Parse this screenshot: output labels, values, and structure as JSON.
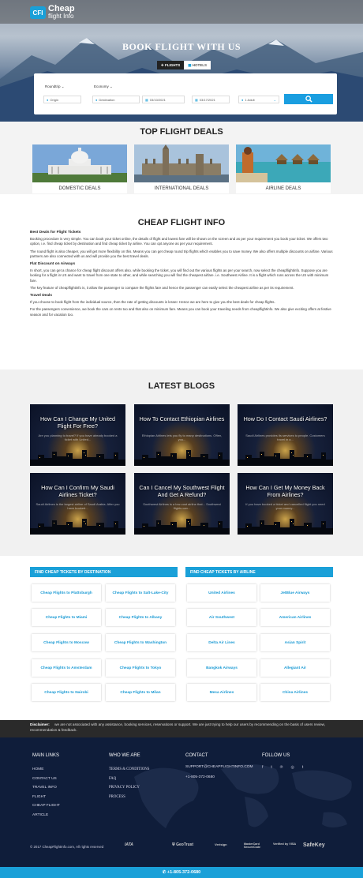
{
  "header": {
    "logo_badge": "CFI",
    "logo_line1": "Cheap",
    "logo_line2": "flight Info"
  },
  "hero": {
    "title": "BOOK FLIGHT WITH US",
    "tabs": [
      {
        "label": "FLIGHTS",
        "icon": "plane-icon",
        "active": true
      },
      {
        "label": "HOTELS",
        "icon": "hotel-icon",
        "active": false
      }
    ],
    "trip_type": "Roundtrip",
    "cabin_class": "Economy",
    "origin_placeholder": "Origin",
    "destination_placeholder": "Destination",
    "depart_date": "03/10/2021",
    "return_date": "03/17/2021",
    "passengers": "1 Adult"
  },
  "deals": {
    "title": "TOP FLIGHT DEALS",
    "items": [
      {
        "label": "DOMESTIC DEALS"
      },
      {
        "label": "INTERNATIONAL DEALS"
      },
      {
        "label": "AIRLINE DEALS"
      }
    ]
  },
  "info": {
    "title": "CHEAP FLIGHT INFO",
    "h1": "Best Deals for Flight Tickets",
    "p1": "Booking procedure is very simple. You can book your ticket online, the details of flight and lowest fare will be shown on the screen and as per your requirement you book your ticket. We offers two option, i.e. find cheap ticket by destination and find cheap ticket by airline. You can opt anyone as per your requirement.",
    "p2": "The round flight is also cheaper, you will get more flexibility on this. Means you can get cheap round trip flights which enables you to save money. We also offers multiple discounts on airfare. Various partners are also connected with us and will provide you the best travel deals.",
    "h2": "Flat Discount on Airways",
    "p3": "In short, you can get a chance for cheap flight discount offers also. while booking the ticket, you will find out the various flights as per your search, now select the cheapflightinfo. Suppose you are looking for a flight in US and want to travel from one state to other, and while searching you will find the cheapest airfare. i.e. Southwest Airline. It is a flight which runs across the US with minimum fare.",
    "p4": "The key feature of cheapflightinfo is, it allow the passenger to compare the flights fare and hence the passenger can easily select the cheapest airline as per its requirement.",
    "h3": "Travel Deals",
    "p5": "If you choose to book flight from the individual source, then the rate of getting discounts is lesser. Hence we are here to give you the best deals for cheap flights.",
    "p6": "For the passengers convenience, we book the cars on rents too and that also on minimum fare. Means you can book your traveling needs from cheapflightinfo. We also give exciting offers at festive season and for vacation too."
  },
  "blogs": {
    "title": "LATEST BLOGS",
    "items": [
      {
        "title": "How Can I Change My United Flight For Free?",
        "excerpt": "Are you planning to travel? If you have already booked a ticket with United..."
      },
      {
        "title": "How To Contact Ethiopian Airlines",
        "excerpt": "Ethiopian Airlines lets you fly to many destinations. Often, you..."
      },
      {
        "title": "How Do I Contact Saudi Airlines?",
        "excerpt": "Saudi Airlines provides its services to people. Customers travel in a..."
      },
      {
        "title": "How Can I Confirm My Saudi Airlines Ticket?",
        "excerpt": "Saudi Airlines is the largest airline of Saudi Arabia. After you have booked..."
      },
      {
        "title": "Can I Cancel My Southwest Flight And Get A Refund?",
        "excerpt": "Southwest Airlines is a low-cost airline that... Southwest flights can..."
      },
      {
        "title": "How Can I Get My Money Back From Airlines?",
        "excerpt": "If you have booked a ticket and cancelled flight you need your money..."
      }
    ]
  },
  "find": {
    "dest_heading": "FIND CHEAP TICKETS BY DESTINATION",
    "airline_heading": "FIND CHEAP TICKETS BY AIRLINE",
    "destinations": [
      "Cheap Flights to Plattsburgh",
      "Cheap Flights to Salt-Lake-City",
      "Cheap Flights to Miami",
      "Cheap Flights to Albany",
      "Cheap Flights to Moscow",
      "Cheap Flights to Washington",
      "Cheap Flights to Amsterdam",
      "Cheap Flights to Tokyo",
      "Cheap Flights to Nairobi",
      "Cheap Flights to Milan"
    ],
    "airlines": [
      "United Airlines",
      "JetBlue Airways",
      "Air Southwest",
      "American Airlines",
      "Delta Air Lines",
      "Asian Spirit",
      "Bangkok Airways",
      "Allegiant Air",
      "Mesa Airlines",
      "China Airlines"
    ]
  },
  "disclaimer": {
    "label": "Disclaimer:",
    "text": "we are not associated with any assistance, booking services, reservations or support. We are just trying to help our users by recommending on the basis of users review, recommendation & feedback."
  },
  "footer": {
    "main_links_title": "MAIN LINKS",
    "main_links": [
      "HOME",
      "CONTACT US",
      "TRAVEL INFO",
      "FLIGHT",
      "CHEAP FLIGHT",
      "ARTICLE"
    ],
    "who_title": "WHO WE ARE",
    "who_links": [
      "TERMS & CONDITIONS",
      "FAQ",
      "PRIVACY POLICY",
      "PROCESS"
    ],
    "contact_title": "CONTACT",
    "contact_email": "SUPPORT@CHEAPFLIGHTINFO.COM",
    "contact_phone": "+1-805-372-0680",
    "follow_title": "FOLLOW US",
    "social_icons": [
      "facebook-icon",
      "twitter-icon",
      "pinterest-icon",
      "instagram-icon",
      "tumblr-icon"
    ],
    "copyright": "© 2017 CheapFlightInfo.com, All rights reserved",
    "partners": [
      "IATA",
      "GeoTrust",
      "Verisign",
      "MasterCard SecureCode",
      "Verified by VISA",
      "SafeKey"
    ]
  },
  "phone_bar": "+1-805-372-0680",
  "colors": {
    "accent": "#1aa0d8",
    "footer_bg": "#0f1d3a",
    "disclaimer_bg": "#2a2a2a"
  }
}
